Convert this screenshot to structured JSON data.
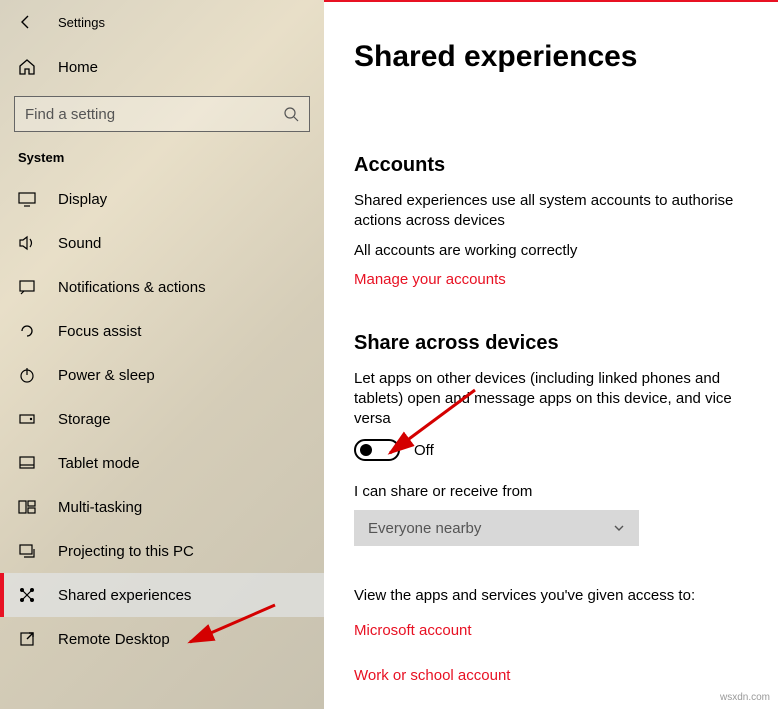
{
  "titlebar": {
    "app": "Settings"
  },
  "home": {
    "label": "Home"
  },
  "search": {
    "placeholder": "Find a setting"
  },
  "sidebar": {
    "section": "System",
    "items": [
      {
        "label": "Display"
      },
      {
        "label": "Sound"
      },
      {
        "label": "Notifications & actions"
      },
      {
        "label": "Focus assist"
      },
      {
        "label": "Power & sleep"
      },
      {
        "label": "Storage"
      },
      {
        "label": "Tablet mode"
      },
      {
        "label": "Multi-tasking"
      },
      {
        "label": "Projecting to this PC"
      },
      {
        "label": "Shared experiences"
      },
      {
        "label": "Remote Desktop"
      }
    ]
  },
  "main": {
    "title": "Shared experiences",
    "accounts": {
      "heading": "Accounts",
      "desc": "Shared experiences use all system accounts to authorise actions across devices",
      "status": "All accounts are working correctly",
      "manage": "Manage your accounts"
    },
    "share": {
      "heading": "Share across devices",
      "desc": "Let apps on other devices (including linked phones and tablets) open and message apps on this device, and vice versa",
      "toggle_state": "Off",
      "receive_label": "I can share or receive from",
      "receive_value": "Everyone nearby",
      "view_apps": "View the apps and services you've given access to:",
      "link_ms": "Microsoft account",
      "link_work": "Work or school account"
    }
  },
  "watermark": "wsxdn.com"
}
